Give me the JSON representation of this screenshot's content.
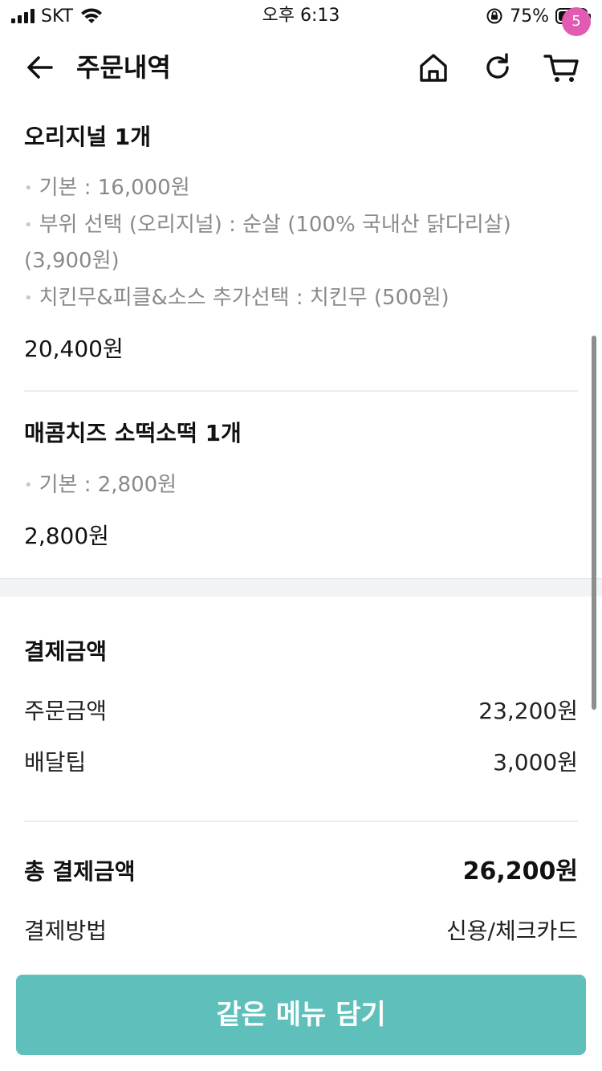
{
  "status_bar": {
    "carrier": "SKT",
    "time": "오후 6:13",
    "battery_percent": "75%",
    "battery_level": 0.75
  },
  "header": {
    "title": "주문내역",
    "cart_count": "5",
    "icons": [
      "back-arrow-icon",
      "home-icon",
      "refresh-icon",
      "cart-icon"
    ]
  },
  "order_items": [
    {
      "name": "오리지널 1개",
      "options": [
        "기본 : 16,000원",
        "부위 선택 (오리지널) : 순살 (100% 국내산 닭다리살) (3,900원)",
        "치킨무&피클&소스 추가선택 : 치킨무 (500원)"
      ],
      "price": "20,400원"
    },
    {
      "name": "매콤치즈 소떡소떡 1개",
      "options": [
        "기본 : 2,800원"
      ],
      "price": "2,800원"
    }
  ],
  "payment": {
    "title": "결제금액",
    "order_amount_label": "주문금액",
    "order_amount": "23,200원",
    "delivery_tip_label": "배달팁",
    "delivery_tip": "3,000원",
    "total_label": "총 결제금액",
    "total": "26,200원",
    "method_label": "결제방법",
    "method": "신용/체크카드"
  },
  "cta": {
    "label": "같은 메뉴 담기"
  },
  "colors": {
    "accent": "#5fc0bb",
    "badge": "#e05bb1"
  }
}
